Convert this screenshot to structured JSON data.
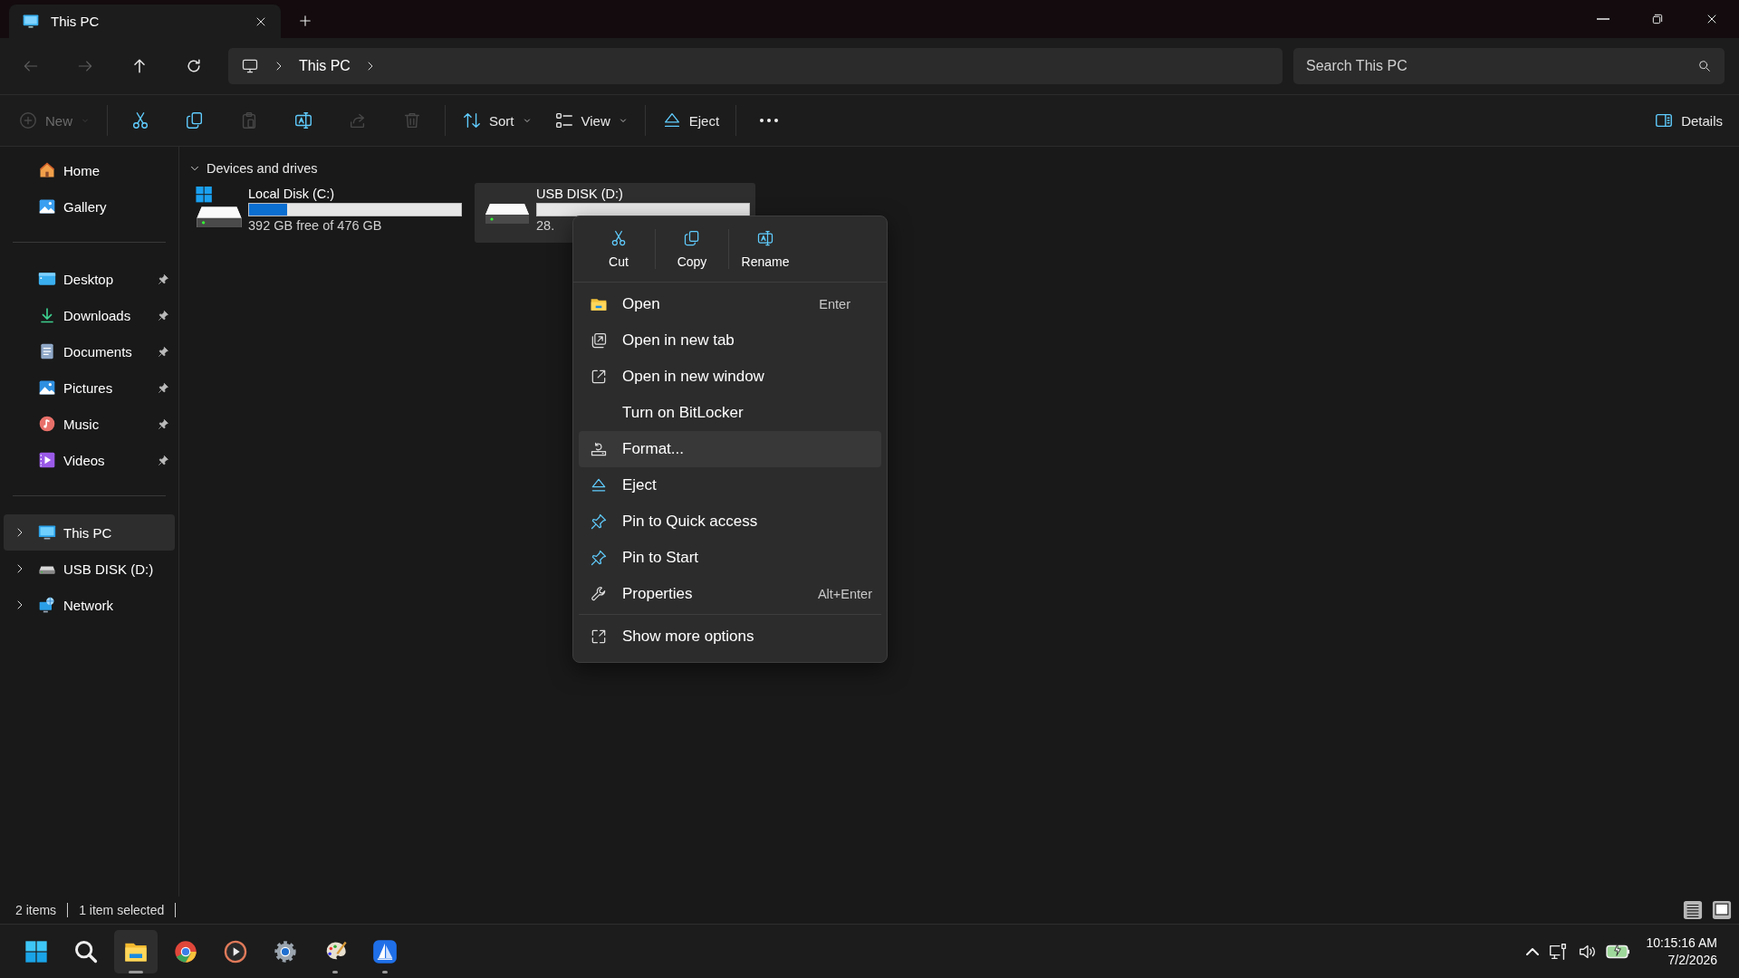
{
  "window": {
    "tabs": [
      {
        "title": "This PC",
        "selected": true
      }
    ]
  },
  "address_bar": {
    "nav_buttons": [
      {
        "kind": "back",
        "disabled": true
      },
      {
        "kind": "forward",
        "disabled": true
      },
      {
        "kind": "up",
        "disabled": false
      },
      {
        "kind": "refresh",
        "disabled": false
      }
    ],
    "path": [
      "This PC"
    ],
    "search": {
      "placeholder": "Search This PC"
    }
  },
  "toolbar": {
    "groups": [
      [
        {
          "kind": "new",
          "label": "New",
          "disabled": true,
          "dropdown": true
        }
      ],
      [
        {
          "kind": "cut",
          "disabled": false
        },
        {
          "kind": "copy",
          "disabled": false
        },
        {
          "kind": "paste",
          "disabled": true
        },
        {
          "kind": "rename",
          "disabled": false
        },
        {
          "kind": "share",
          "disabled": true
        },
        {
          "kind": "delete",
          "disabled": true
        }
      ],
      [
        {
          "kind": "sort",
          "label": "Sort",
          "disabled": false,
          "dropdown": true
        },
        {
          "kind": "view",
          "label": "View",
          "disabled": false,
          "dropdown": true
        }
      ],
      [
        {
          "kind": "eject",
          "label": "Eject",
          "disabled": false
        }
      ],
      [
        {
          "kind": "more",
          "disabled": false
        }
      ]
    ],
    "details": {
      "label": "Details"
    }
  },
  "sidebar": {
    "quick": [
      {
        "kind": "home",
        "label": "Home"
      },
      {
        "kind": "gallery",
        "label": "Gallery"
      }
    ],
    "pinned": [
      {
        "kind": "desktop",
        "label": "Desktop",
        "pinned": true
      },
      {
        "kind": "downloads",
        "label": "Downloads",
        "pinned": true
      },
      {
        "kind": "documents",
        "label": "Documents",
        "pinned": true
      },
      {
        "kind": "pictures",
        "label": "Pictures",
        "pinned": true
      },
      {
        "kind": "music",
        "label": "Music",
        "pinned": true
      },
      {
        "kind": "videos",
        "label": "Videos",
        "pinned": true
      }
    ],
    "tree": [
      {
        "kind": "pc",
        "label": "This PC",
        "expanded": false,
        "selected": true
      },
      {
        "kind": "usb",
        "label": "USB DISK (D:)",
        "expanded": false,
        "selected": false
      },
      {
        "kind": "network",
        "label": "Network",
        "expanded": false,
        "selected": false
      }
    ]
  },
  "content": {
    "group": {
      "title": "Devices and drives",
      "expanded": true
    },
    "drives": [
      {
        "kind": "system",
        "name": "Local Disk (C:)",
        "level": 0.18,
        "info": "392 GB free of 476 GB",
        "selected": false
      },
      {
        "kind": "removable",
        "name": "USB DISK (D:)",
        "level": 0,
        "info": "28.",
        "selected": true
      }
    ]
  },
  "context_menu": {
    "quick_actions": [
      {
        "kind": "cut",
        "label": "Cut"
      },
      {
        "kind": "copy",
        "label": "Copy"
      },
      {
        "kind": "rename",
        "label": "Rename"
      }
    ],
    "items": [
      {
        "kind": "open",
        "label": "Open",
        "shortcut": "Enter",
        "selected": false
      },
      {
        "kind": "open-tab",
        "label": "Open in new tab",
        "selected": false
      },
      {
        "kind": "open-window",
        "label": "Open in new window",
        "selected": false
      },
      {
        "kind": "none",
        "label": "Turn on BitLocker",
        "selected": false
      },
      {
        "kind": "format",
        "label": "Format...",
        "selected": true
      },
      {
        "kind": "eject",
        "label": "Eject",
        "selected": false
      },
      {
        "kind": "pin",
        "label": "Pin to Quick access",
        "selected": false
      },
      {
        "kind": "pin",
        "label": "Pin to Start",
        "selected": false
      },
      {
        "kind": "properties",
        "label": "Properties",
        "shortcut": "Alt+Enter",
        "selected": false
      }
    ],
    "more": {
      "kind": "more-options",
      "label": "Show more options"
    }
  },
  "status_bar": {
    "texts": [
      "2 items",
      "1 item selected"
    ],
    "views": [
      {
        "kind": "details"
      },
      {
        "kind": "tiles"
      }
    ]
  },
  "taskbar": {
    "apps": [
      {
        "kind": "start",
        "active": false,
        "running": false
      },
      {
        "kind": "search",
        "active": false,
        "running": false
      },
      {
        "kind": "explorer",
        "active": true,
        "running": true
      },
      {
        "kind": "browser",
        "active": false,
        "running": false
      },
      {
        "kind": "media",
        "active": false,
        "running": false
      },
      {
        "kind": "settings",
        "active": false,
        "running": false
      },
      {
        "kind": "paint",
        "active": false,
        "running": true
      },
      {
        "kind": "sail",
        "active": false,
        "running": true
      }
    ],
    "clock": {
      "time": "10:15:16 AM",
      "date": "7/2/2026"
    }
  }
}
